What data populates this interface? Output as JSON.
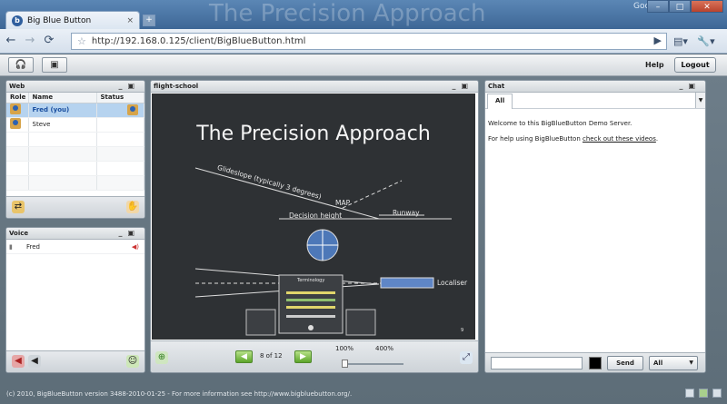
{
  "browser": {
    "tab_title": "Big Blue Button",
    "tab_close": "×",
    "new_tab": "+",
    "google_label": "Google",
    "url": "http://192.168.0.125/client/BigBlueButton.html",
    "background_title": "The Precision Approach",
    "window_buttons": {
      "minimize": "–",
      "maximize": "□",
      "close": "✕"
    }
  },
  "app": {
    "help_label": "Help",
    "logout_label": "Logout",
    "users_panel": {
      "title": "Web",
      "columns": [
        "Role",
        "Name",
        "Status"
      ],
      "users": [
        {
          "name": "Fred (you)",
          "selected": true,
          "has_status": true
        },
        {
          "name": "Steve",
          "selected": false,
          "has_status": false
        }
      ]
    },
    "voice_panel": {
      "title": "Voice",
      "participants": [
        {
          "name": "Fred"
        }
      ]
    },
    "presentation_panel": {
      "title": "flight-school",
      "slide": {
        "title": "The Precision Approach",
        "labels": {
          "glideslope": "Glideslope (typically 3 degrees)",
          "map": "MAP",
          "decision_height": "Decision height",
          "runway": "Runway",
          "localiser": "Localiser",
          "terminology": "Terminology"
        },
        "page_number": "9"
      },
      "pager": "8 of 12",
      "zoom_min": "100%",
      "zoom_max": "400%",
      "zoom_level": 0.03
    },
    "chat_panel": {
      "title": "Chat",
      "tab_all": "All",
      "welcome": "Welcome to this BigBlueButton Demo Server.",
      "help_prefix": "For help using BigBlueButton ",
      "help_link": "check out these videos",
      "help_suffix": ".",
      "send_label": "Send",
      "recipient": "All",
      "input_value": ""
    },
    "footer": "(c) 2010, BigBlueButton version 3488-2010-01-25 - For more information see http://www.bigbluebutton.org/."
  },
  "colors": {
    "selected_row": "#b6d3ef",
    "slide_background": "#2e3134",
    "arrow_green": "#5ca52a",
    "link_blue": "#1a4fa0"
  }
}
